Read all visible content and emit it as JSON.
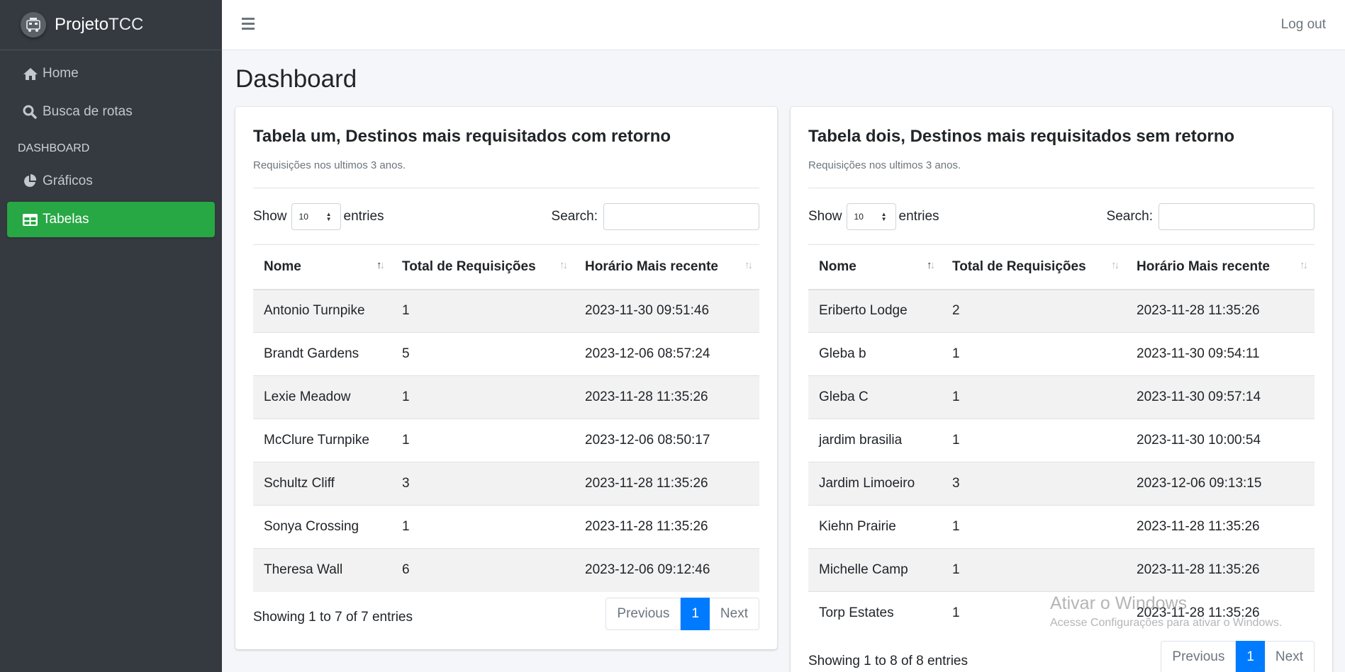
{
  "brand": {
    "bold": "Projeto",
    "light": "TCC"
  },
  "sidebar": {
    "items": [
      {
        "label": "Home",
        "icon": "home-icon"
      },
      {
        "label": "Busca de rotas",
        "icon": "search-icon"
      }
    ],
    "header": "DASHBOARD",
    "dash_items": [
      {
        "label": "Gráficos",
        "icon": "pie-chart-icon"
      },
      {
        "label": "Tabelas",
        "icon": "table-icon",
        "active": true
      }
    ]
  },
  "topbar": {
    "logout": "Log out"
  },
  "page": {
    "title": "Dashboard"
  },
  "common": {
    "show": "Show",
    "entries": "entries",
    "length_value": "10",
    "search_label": "Search:",
    "prev": "Previous",
    "next": "Next",
    "page_number": "1",
    "accent": "#28a745",
    "pager_accent": "#007bff"
  },
  "table1": {
    "title": "Tabela um, Destinos mais requisitados com retorno",
    "subtitle": "Requisições nos ultimos 3 anos.",
    "columns": [
      "Nome",
      "Total de Requisições",
      "Horário Mais recente"
    ],
    "rows": [
      [
        "Antonio Turnpike",
        "1",
        "2023-11-30 09:51:46"
      ],
      [
        "Brandt Gardens",
        "5",
        "2023-12-06 08:57:24"
      ],
      [
        "Lexie Meadow",
        "1",
        "2023-11-28 11:35:26"
      ],
      [
        "McClure Turnpike",
        "1",
        "2023-12-06 08:50:17"
      ],
      [
        "Schultz Cliff",
        "3",
        "2023-11-28 11:35:26"
      ],
      [
        "Sonya Crossing",
        "1",
        "2023-11-28 11:35:26"
      ],
      [
        "Theresa Wall",
        "6",
        "2023-12-06 09:12:46"
      ]
    ],
    "info": "Showing 1 to 7 of 7 entries"
  },
  "table2": {
    "title": "Tabela dois, Destinos mais requisitados sem retorno",
    "subtitle": "Requisições nos ultimos 3 anos.",
    "columns": [
      "Nome",
      "Total de Requisições",
      "Horário Mais recente"
    ],
    "rows": [
      [
        "Eriberto Lodge",
        "2",
        "2023-11-28 11:35:26"
      ],
      [
        "Gleba b",
        "1",
        "2023-11-30 09:54:11"
      ],
      [
        "Gleba C",
        "1",
        "2023-11-30 09:57:14"
      ],
      [
        "jardim brasilia",
        "1",
        "2023-11-30 10:00:54"
      ],
      [
        "Jardim Limoeiro",
        "3",
        "2023-12-06 09:13:15"
      ],
      [
        "Kiehn Prairie",
        "1",
        "2023-11-28 11:35:26"
      ],
      [
        "Michelle Camp",
        "1",
        "2023-11-28 11:35:26"
      ],
      [
        "Torp Estates",
        "1",
        "2023-11-28 11:35:26"
      ]
    ],
    "info": "Showing 1 to 8 of 8 entries"
  },
  "watermark": {
    "line1": "Ativar o Windows",
    "line2": "Acesse Configurações para ativar o Windows."
  }
}
